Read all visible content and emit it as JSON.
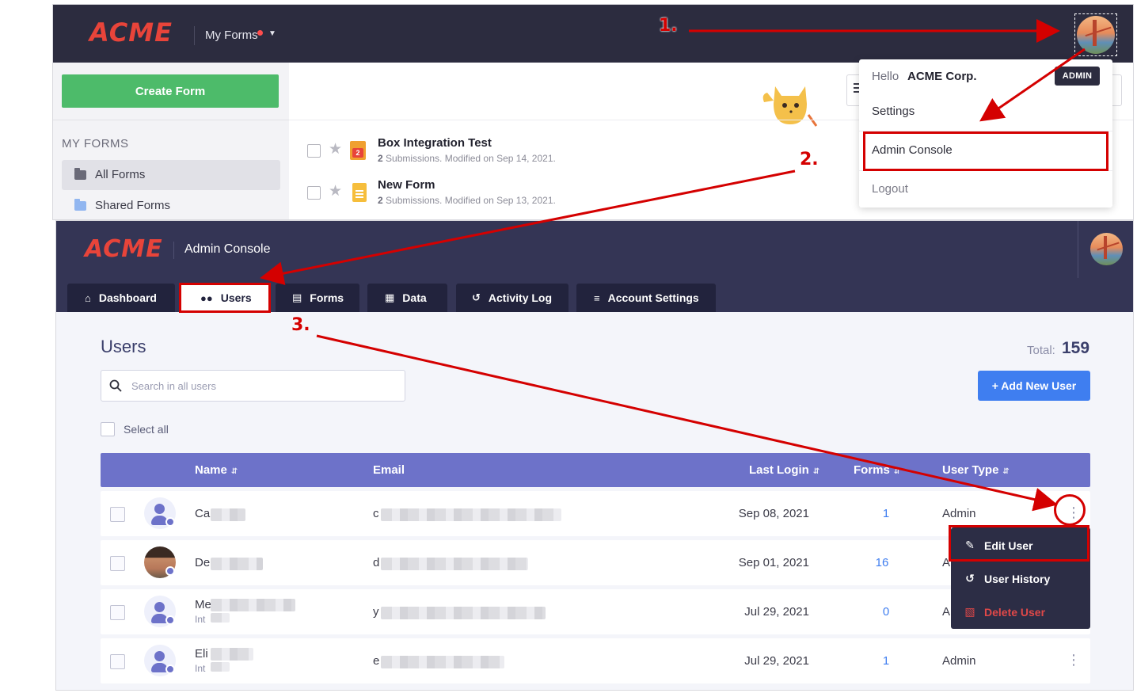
{
  "top": {
    "logo": "ACME",
    "nav_menu_label": "My Forms",
    "create_form_label": "Create Form",
    "sidebar_heading": "MY FORMS",
    "sidebar_items": [
      {
        "label": "All Forms",
        "icon": "folder-icon"
      },
      {
        "label": "Shared Forms",
        "icon": "folder-icon"
      }
    ],
    "forms": [
      {
        "title": "Box Integration Test",
        "submissions": "2",
        "meta_suffix": "Submissions. Modified on Sep 14, 2021.",
        "badge": "2"
      },
      {
        "title": "New Form",
        "submissions": "2",
        "meta_suffix": "Submissions. Modified on Sep 13, 2021."
      }
    ],
    "profile_menu": {
      "hello": "Hello",
      "account_name": "ACME Corp.",
      "role_badge": "ADMIN",
      "items": [
        "Settings",
        "Admin Console",
        "Logout"
      ]
    }
  },
  "admin": {
    "logo": "ACME",
    "title": "Admin Console",
    "tabs": [
      {
        "label": "Dashboard",
        "icon": "home-icon"
      },
      {
        "label": "Users",
        "icon": "users-icon"
      },
      {
        "label": "Forms",
        "icon": "forms-icon"
      },
      {
        "label": "Data",
        "icon": "data-icon"
      },
      {
        "label": "Activity Log",
        "icon": "history-icon"
      },
      {
        "label": "Account Settings",
        "icon": "sliders-icon"
      }
    ],
    "page_title": "Users",
    "total_label": "Total:",
    "total_value": "159",
    "search_placeholder": "Search in all users",
    "add_user_label": "+ Add New User",
    "select_all_label": "Select all",
    "columns": [
      "Name",
      "Email",
      "Last Login",
      "Forms",
      "User Type"
    ],
    "rows": [
      {
        "name": "Ca",
        "sub": "",
        "email": "c",
        "last_login": "Sep 08, 2021",
        "forms": "1",
        "user_type": "Admin"
      },
      {
        "name": "De",
        "sub": "",
        "email": "d",
        "last_login": "Sep 01, 2021",
        "forms": "16",
        "user_type": "A"
      },
      {
        "name": "Me",
        "sub": "Int",
        "email": "y",
        "last_login": "Jul 29, 2021",
        "forms": "0",
        "user_type": "A"
      },
      {
        "name": "Eli",
        "sub": "Int",
        "email": "e",
        "last_login": "Jul 29, 2021",
        "forms": "1",
        "user_type": "Admin"
      }
    ],
    "row_menu": [
      "Edit User",
      "User History",
      "Delete User"
    ]
  },
  "annotations": {
    "step1": "1.",
    "step2": "2.",
    "step3": "3."
  },
  "colors": {
    "top_nav": "#2c2c3f",
    "admin_nav": "#343555",
    "create_form": "#4dbb6a",
    "table_header": "#6d72c9",
    "primary_button": "#3f7ef0",
    "annotation_red": "#d40000"
  }
}
